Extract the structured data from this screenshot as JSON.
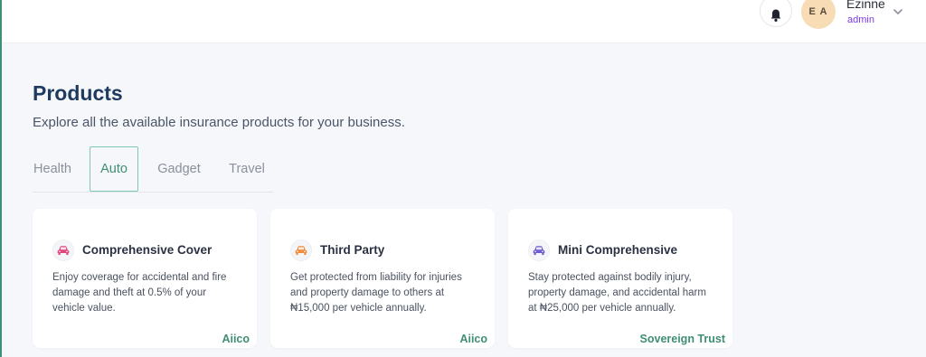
{
  "header": {
    "avatar_initials": "E A",
    "user_name": "Ezinne",
    "user_role": "admin",
    "icons": [
      "bell-icon",
      "chevron-down-icon"
    ]
  },
  "main": {
    "title": "Products",
    "subtitle": "Explore all the available insurance products for your business.",
    "tabs": [
      {
        "label": "Health",
        "active": false
      },
      {
        "label": "Auto",
        "active": true
      },
      {
        "label": "Gadget",
        "active": false
      },
      {
        "label": "Travel",
        "active": false
      }
    ],
    "cards": [
      {
        "title": "Comprehensive Cover",
        "icon": "car-icon",
        "icon_color": "#e0457b",
        "desc_lines": [
          "Enjoy coverage for accidental and fire",
          "damage and theft at 0.5% of your",
          "vehicle value."
        ],
        "provider": "Aiico"
      },
      {
        "title": "Third Party",
        "icon": "car-icon",
        "icon_color": "#f08a3c",
        "desc_lines": [
          "Get protected from liability for injuries",
          "and property damage to others at",
          "₦15,000 per vehicle annually."
        ],
        "provider": "Aiico"
      },
      {
        "title": "Mini Comprehensive",
        "icon": "car-icon",
        "icon_color": "#6d5bd0",
        "desc_lines": [
          "Stay protected against bodily injury,",
          "property damage, and accidental harm",
          "at ₦25,000 per vehicle annually."
        ],
        "provider": "Sovereign Trust"
      }
    ]
  },
  "colors": {
    "accent": "#3f8f72",
    "title": "#1e3a5f",
    "role": "#7c3aed"
  }
}
